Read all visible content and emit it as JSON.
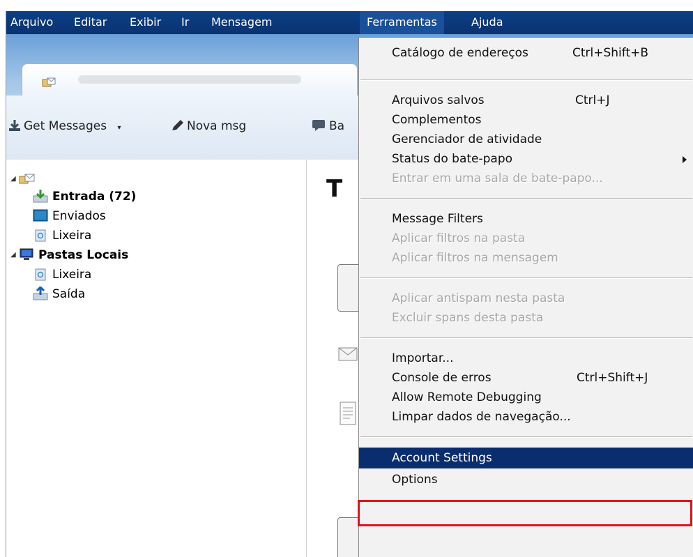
{
  "menubar": {
    "items": [
      {
        "id": "arquivo",
        "label": "Arquivo"
      },
      {
        "id": "editar",
        "label": "Editar"
      },
      {
        "id": "exibir",
        "label": "Exibir"
      },
      {
        "id": "ir",
        "label": "Ir"
      },
      {
        "id": "mensagem",
        "label": "Mensagem"
      },
      {
        "id": "ferramentas",
        "label": "Ferramentas"
      },
      {
        "id": "ajuda",
        "label": "Ajuda"
      }
    ]
  },
  "toolbar": {
    "get_messages": "Get Messages",
    "nova_msg": "Nova msg",
    "bate_papo_partial": "Ba"
  },
  "folders": {
    "entrada": "Entrada (72)",
    "enviados": "Enviados",
    "lixeira1": "Lixeira",
    "pastas_locais": "Pastas Locais",
    "lixeira2": "Lixeira",
    "saida": "Saída"
  },
  "content": {
    "heading_partial": "T"
  },
  "tools_menu": {
    "catalogo": {
      "label": "Catálogo de endereços",
      "shortcut": "Ctrl+Shift+B"
    },
    "arquivos_salvos": {
      "label": "Arquivos salvos",
      "shortcut": "Ctrl+J"
    },
    "complementos": {
      "label": "Complementos"
    },
    "gerenciador": {
      "label": "Gerenciador de atividade"
    },
    "status_bate_papo": {
      "label": "Status do bate-papo"
    },
    "entrar_sala": {
      "label": "Entrar em uma sala de bate-papo..."
    },
    "message_filters": {
      "label": "Message Filters"
    },
    "aplicar_filtros_pasta": {
      "label": "Aplicar filtros na pasta"
    },
    "aplicar_filtros_msg": {
      "label": "Aplicar filtros na mensagem"
    },
    "aplicar_antispam": {
      "label": "Aplicar antispam nesta pasta"
    },
    "excluir_spams": {
      "label": "Excluir spans desta pasta"
    },
    "importar": {
      "label": "Importar..."
    },
    "console_erros": {
      "label": "Console de erros",
      "shortcut": "Ctrl+Shift+J"
    },
    "remote_debug": {
      "label": "Allow Remote Debugging"
    },
    "limpar_dados": {
      "label": "Limpar dados de navegação..."
    },
    "account_settings": {
      "label": "Account Settings"
    },
    "options": {
      "label": "Options"
    }
  },
  "colors": {
    "menubar": "#0c3270",
    "highlight": "#0a2d6e",
    "callout": "#e4121b"
  }
}
